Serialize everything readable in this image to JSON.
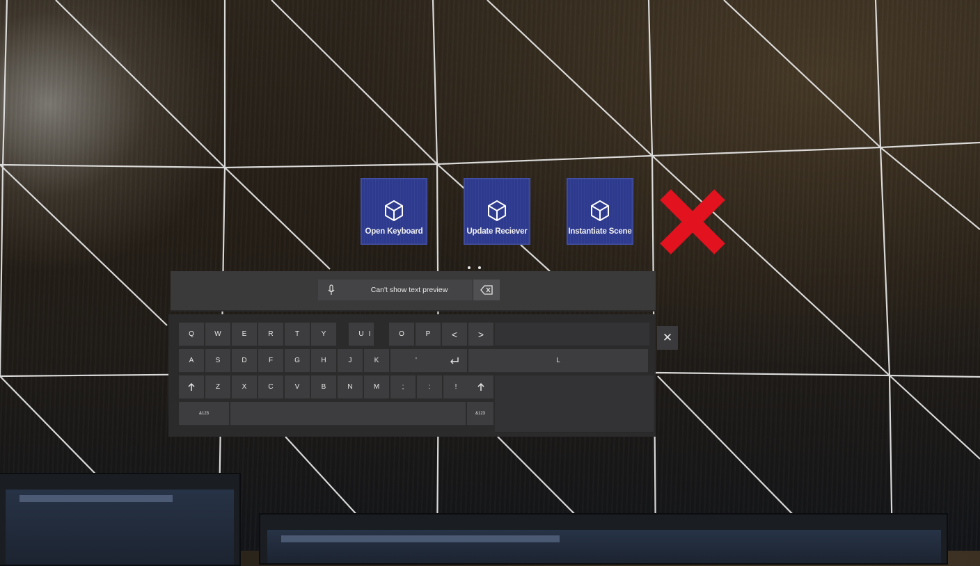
{
  "app_buttons": [
    {
      "label": "Open Keyboard",
      "icon": "cube-icon"
    },
    {
      "label": "Update Reciever",
      "icon": "cube-icon"
    },
    {
      "label": "Instantiate Scene",
      "icon": "cube-icon"
    }
  ],
  "close_icon_color": "#e3121f",
  "button_color": "#2e3a8e",
  "keyboard": {
    "preview_text": "Can't show text preview",
    "row1": [
      "Q",
      "W",
      "E",
      "R",
      "T",
      "Y",
      "U",
      "I",
      "O",
      "P",
      "<",
      ">"
    ],
    "row2": [
      "A",
      "S",
      "D",
      "F",
      "G",
      "H",
      "J",
      "K",
      "'",
      "L"
    ],
    "row3": [
      "Z",
      "X",
      "C",
      "V",
      "B",
      "N",
      "M",
      ";",
      ":",
      "!"
    ],
    "symbols_left": "&123",
    "symbols_right": "&123",
    "close_label": "✕"
  }
}
